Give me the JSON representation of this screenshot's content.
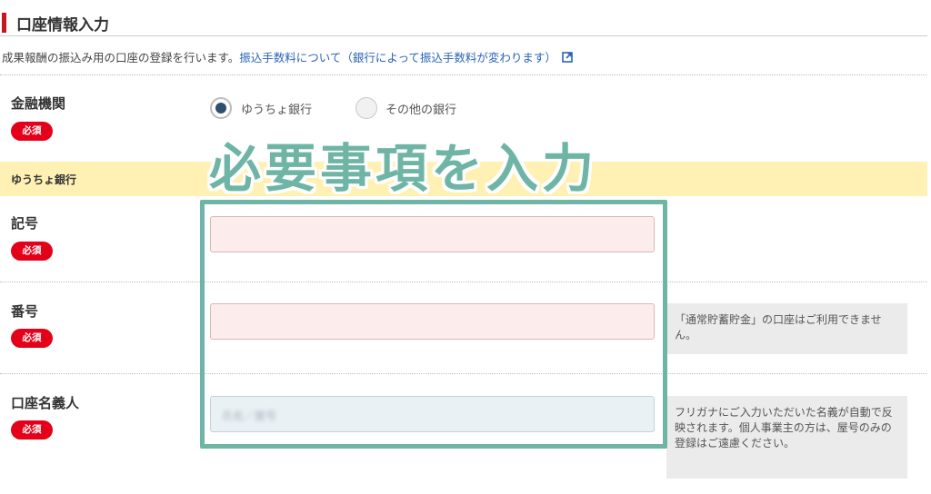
{
  "section": {
    "title": "口座情報入力",
    "description": "成果報酬の振込み用の口座の登録を行います。",
    "fee_link": "振込手数料について（銀行によって振込手数料が変わります）"
  },
  "required_label": "必須",
  "bank": {
    "label": "金融機関",
    "options": [
      "ゆうちょ銀行",
      "その他の銀行"
    ],
    "selected": "ゆうちょ銀行"
  },
  "yucho_section": {
    "label": "ゆうちょ銀行"
  },
  "fields": {
    "kigo": {
      "label": "記号",
      "value": ""
    },
    "bango": {
      "label": "番号",
      "value": "",
      "note": "「通常貯蓄貯金」の口座はご利用できません。"
    },
    "meigi": {
      "label": "口座名義人",
      "value": "",
      "placeholder": "氏名／屋号",
      "note": "フリガナにご入力いただいた名義が自動で反映されます。個人事業主の方は、屋号のみの登録はご遠慮ください。"
    }
  },
  "overlay": {
    "text": "必要事項を入力",
    "color": "#6eb5a5"
  },
  "colors": {
    "accent": "#c8161d",
    "required_badge": "#e5001a",
    "link": "#2a64b5",
    "band": "#fff1b4"
  }
}
